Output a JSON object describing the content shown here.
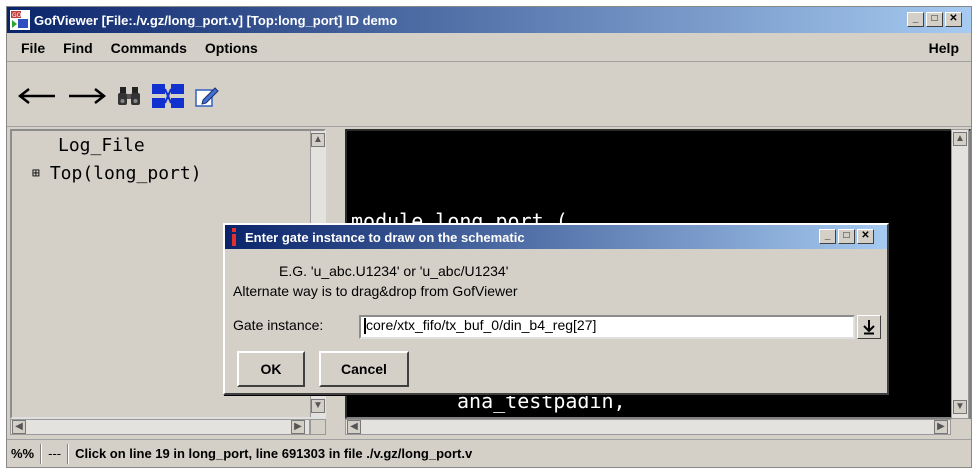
{
  "window": {
    "title": "GofViewer [File:./v.gz/long_port.v] [Top:long_port] ID demo"
  },
  "menu": {
    "file": "File",
    "find": "Find",
    "commands": "Commands",
    "options": "Options",
    "help": "Help"
  },
  "toolbar": {
    "icons": [
      "back-arrow-icon",
      "forward-arrow-icon",
      "binoculars-icon",
      "schematic-icon",
      "edit-icon"
    ]
  },
  "tree": {
    "items": [
      {
        "label": "Log_File",
        "expander": ""
      },
      {
        "label": "Top(long_port)",
        "expander": "⊞"
      }
    ]
  },
  "code": {
    "lines": [
      "module long_port (",
      "ana_testpadin,"
    ]
  },
  "dialog": {
    "title": "Enter gate instance to draw on the schematic",
    "example": "E.G. 'u_abc.U1234' or 'u_abc/U1234'",
    "hint": "Alternate way is to drag&drop from GofViewer",
    "gate_label": "Gate instance:",
    "gate_value": "core/xtx_fifo/tx_buf_0/din_b4_reg[27]",
    "ok": "OK",
    "cancel": "Cancel"
  },
  "status": {
    "zoom": "%%",
    "separator": "---",
    "message": "Click on line 19 in long_port, line 691303 in file ./v.gz/long_port.v"
  }
}
